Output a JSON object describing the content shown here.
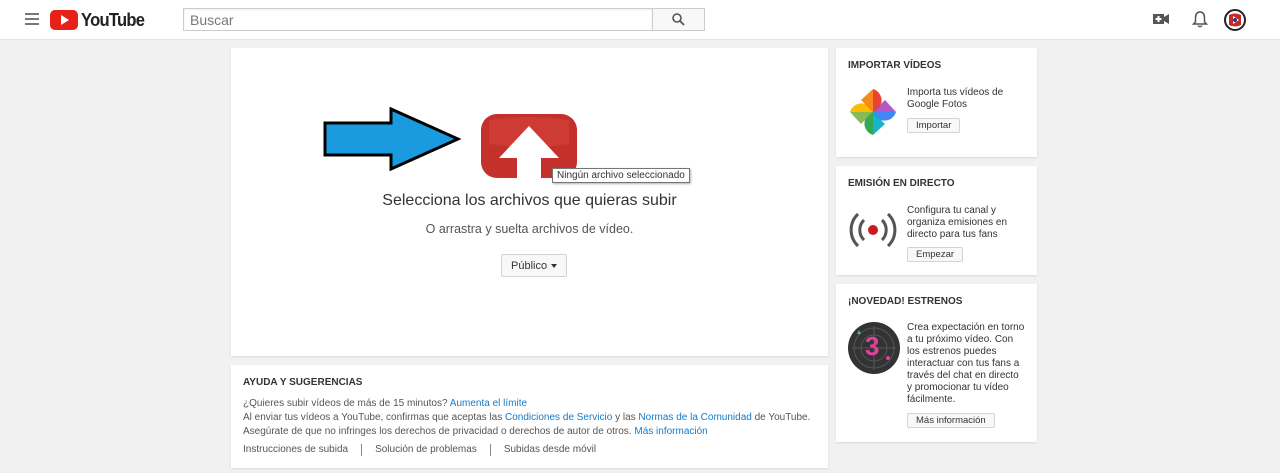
{
  "header": {
    "logo_text": "YouTube",
    "search_placeholder": "Buscar"
  },
  "upload": {
    "tooltip": "Ningún archivo seleccionado",
    "title": "Selecciona los archivos que quieras subir",
    "subtitle": "O arrastra y suelta archivos de vídeo.",
    "privacy_label": "Público"
  },
  "help": {
    "title": "AYUDA Y SUGERENCIAS",
    "line1_text": "¿Quieres subir vídeos de más de 15 minutos?",
    "line1_link": "Aumenta el límite",
    "line2_a": "Al enviar tus vídeos a YouTube, confirmas que aceptas las",
    "line2_link1": "Condiciones de Servicio",
    "line2_b": "y las",
    "line2_link2": "Normas de la Comunidad",
    "line2_c": "de YouTube.",
    "line3_text": "Asegúrate de que no infringes los derechos de privacidad o derechos de autor de otros.",
    "line3_link": "Más información",
    "links": [
      "Instrucciones de subida",
      "Solución de problemas",
      "Subidas desde móvil"
    ]
  },
  "import": {
    "title": "IMPORTAR VÍDEOS",
    "text": "Importa tus vídeos de Google Fotos",
    "button": "Importar"
  },
  "live": {
    "title": "EMISIÓN EN DIRECTO",
    "text": "Configura tu canal y organiza emisiones en directo para tus fans",
    "button": "Empezar"
  },
  "premiere": {
    "title": "¡NOVEDAD! ESTRENOS",
    "text": "Crea expectación en torno a tu próximo vídeo. Con los estrenos puedes interactuar con tus fans a través del chat en directo y promocionar tu vídeo fácilmente.",
    "badge": "3",
    "button": "Más información"
  },
  "colors": {
    "brand_red": "#e62117",
    "upload_red": "#c4302b",
    "link_blue": "#167ac6",
    "arrow_blue": "#1a9be0"
  }
}
